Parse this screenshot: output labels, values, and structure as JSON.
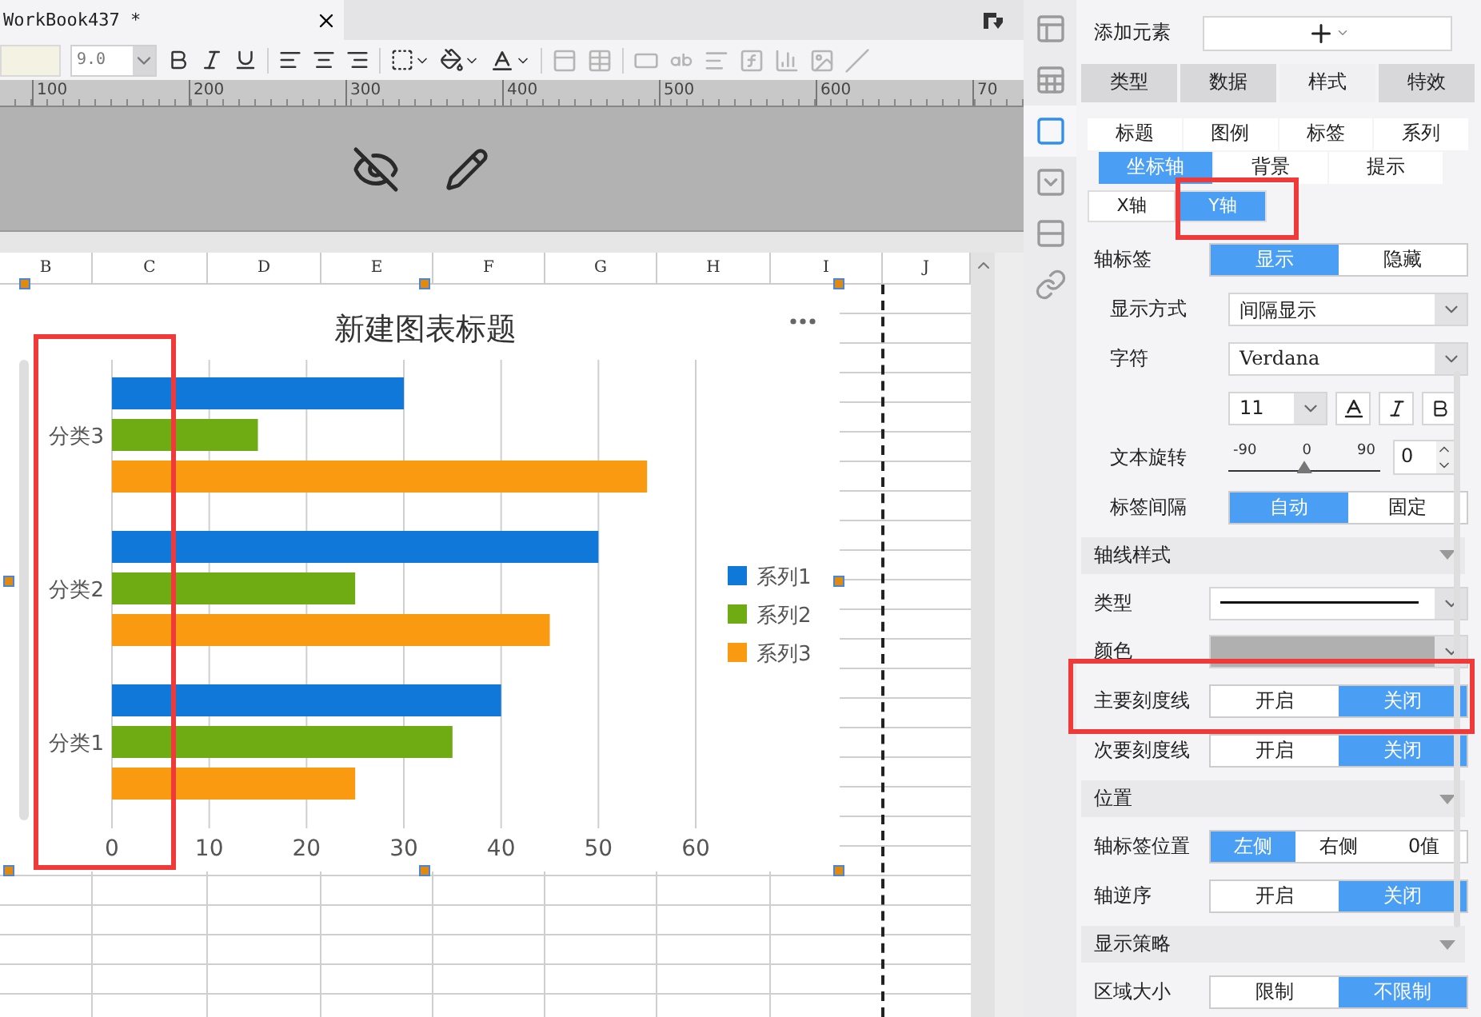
{
  "document_tab": {
    "title": "WorkBook437 *"
  },
  "toolbar": {
    "font_size": "9.0"
  },
  "ruler": {
    "labels": [
      "100",
      "200",
      "300",
      "400",
      "500",
      "600",
      "70"
    ]
  },
  "column_headers": [
    "B",
    "C",
    "D",
    "E",
    "F",
    "G",
    "H",
    "I",
    "J"
  ],
  "chart": {
    "chart_data": {
      "type": "bar",
      "orientation": "horizontal",
      "title": "新建图表标题",
      "categories": [
        "分类3",
        "分类2",
        "分类1"
      ],
      "series": [
        {
          "name": "系列1",
          "color": "#0f78d8",
          "values": [
            30,
            50,
            40
          ]
        },
        {
          "name": "系列2",
          "color": "#6fab12",
          "values": [
            15,
            25,
            35
          ]
        },
        {
          "name": "系列3",
          "color": "#f99a10",
          "values": [
            55,
            45,
            25
          ]
        }
      ],
      "grid": true,
      "legend": true,
      "xlim": [
        0,
        60
      ],
      "xticks": [
        0,
        10,
        20,
        30,
        40,
        50,
        60
      ]
    }
  },
  "side_icons": [
    {
      "kind": "layout",
      "selected": false
    },
    {
      "kind": "table_info",
      "selected": false
    },
    {
      "kind": "frame",
      "selected": true
    },
    {
      "kind": "dropdown",
      "selected": false
    },
    {
      "kind": "rows",
      "selected": false
    },
    {
      "kind": "link",
      "selected": false
    }
  ],
  "panel": {
    "add_element": {
      "label": "添加元素"
    },
    "main_tabs": [
      {
        "label": "类型",
        "selected": false
      },
      {
        "label": "数据",
        "selected": false
      },
      {
        "label": "样式",
        "selected": true
      },
      {
        "label": "特效",
        "selected": false
      }
    ],
    "sub_tab_rows": [
      {
        "tabs": [
          {
            "label": "标题",
            "selected": false
          },
          {
            "label": "图例",
            "selected": false
          },
          {
            "label": "标签",
            "selected": false
          },
          {
            "label": "系列",
            "selected": false
          }
        ]
      },
      {
        "tabs": [
          {
            "label": "坐标轴",
            "selected": true
          },
          {
            "label": "背景",
            "selected": false
          },
          {
            "label": "提示",
            "selected": false
          }
        ]
      }
    ],
    "axis_tabs": [
      {
        "label": "X轴",
        "selected": false
      },
      {
        "label": "Y轴",
        "selected": true
      }
    ],
    "axis_label": {
      "label": "轴标签",
      "options": [
        {
          "label": "显示",
          "selected": true
        },
        {
          "label": "隐藏",
          "selected": false
        }
      ],
      "children": [
        {
          "kind": "select",
          "label": "显示方式",
          "value": "间隔显示"
        },
        {
          "kind": "select",
          "label": "字符",
          "value": "Verdana"
        },
        {
          "kind": "font_style",
          "size": "11"
        },
        {
          "kind": "slider",
          "label": "文本旋转",
          "ticks": [
            "-90",
            "0",
            "90"
          ],
          "level": 0.5,
          "value": "0"
        },
        {
          "kind": "toggle",
          "label": "标签间隔",
          "options": [
            {
              "label": "自动",
              "selected": true
            },
            {
              "label": "固定",
              "selected": false
            }
          ]
        }
      ]
    },
    "sections": [
      {
        "title": "轴线样式",
        "rows": [
          {
            "kind": "line_select",
            "label": "类型"
          },
          {
            "kind": "color_select",
            "label": "颜色"
          },
          {
            "kind": "toggle",
            "label": "主要刻度线",
            "options": [
              {
                "label": "开启",
                "selected": false
              },
              {
                "label": "关闭",
                "selected": true
              }
            ]
          },
          {
            "kind": "toggle",
            "label": "次要刻度线",
            "options": [
              {
                "label": "开启",
                "selected": false
              },
              {
                "label": "关闭",
                "selected": true
              }
            ]
          }
        ]
      },
      {
        "title": "位置",
        "rows": [
          {
            "kind": "toggle",
            "label": "轴标签位置",
            "options": [
              {
                "label": "左侧",
                "selected": true
              },
              {
                "label": "右侧",
                "selected": false
              },
              {
                "label": "0值",
                "selected": false
              }
            ]
          },
          {
            "kind": "toggle",
            "label": "轴逆序",
            "options": [
              {
                "label": "开启",
                "selected": false
              },
              {
                "label": "关闭",
                "selected": true
              }
            ]
          }
        ]
      },
      {
        "title": "显示策略",
        "rows": [
          {
            "kind": "toggle",
            "label": "区域大小",
            "options": [
              {
                "label": "限制",
                "selected": false
              },
              {
                "label": "不限制",
                "selected": true
              }
            ]
          }
        ]
      }
    ]
  }
}
